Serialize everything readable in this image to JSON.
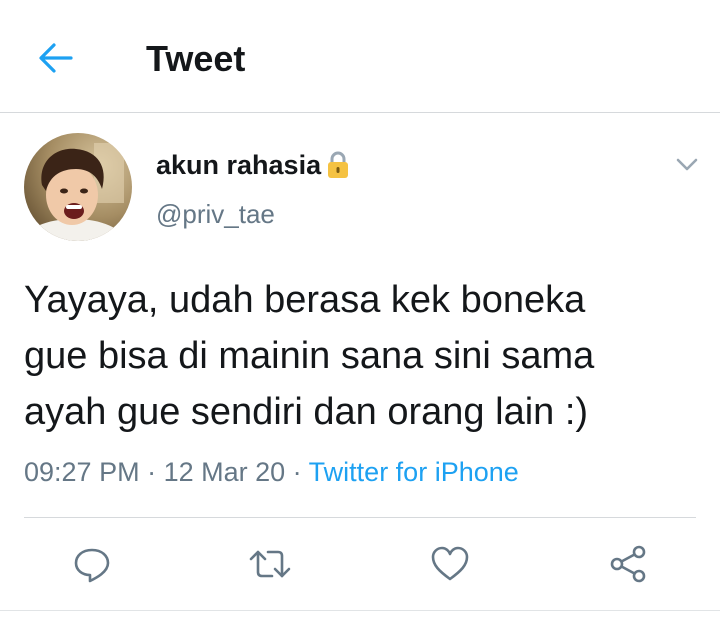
{
  "header": {
    "title": "Tweet",
    "back_icon": "back-arrow-icon"
  },
  "author": {
    "display_name": "akun rahasia",
    "handle": "@priv_tae",
    "protected_icon": "lock-icon"
  },
  "tweet": {
    "lines": [
      "Yayaya, udah berasa kek boneka",
      "gue bisa di mainin sana sini sama",
      "ayah gue sendiri dan orang lain :)"
    ],
    "time": "09:27 PM",
    "separator": " · ",
    "date": "12 Mar 20",
    "source": "Twitter for iPhone"
  },
  "actions": [
    "reply-icon",
    "retweet-icon",
    "like-icon",
    "share-icon"
  ],
  "colors": {
    "accent": "#1da1f2",
    "text": "#14171a",
    "muted": "#657786",
    "icon": "#657786",
    "lock": "#f5c242"
  }
}
